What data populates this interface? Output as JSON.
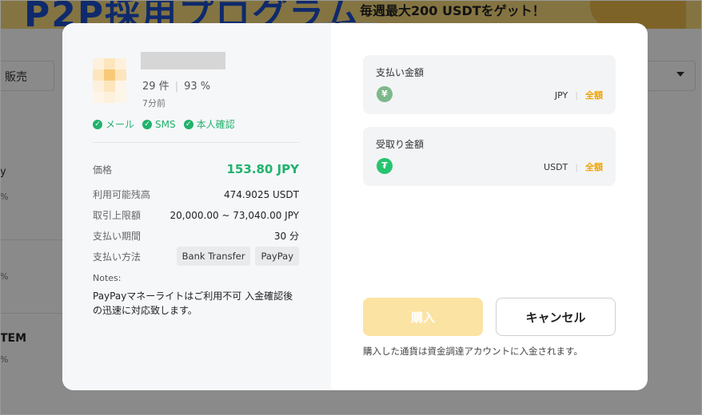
{
  "background": {
    "banner_big_text": "P2P採用プログラム",
    "banner_promo_text": "毎週最大200 USDTをゲット！",
    "filter_select_text": "販売",
    "partial_row_1": "y",
    "partial_row_1b": "%",
    "partial_row_2": "%",
    "partial_row_3": "TEM",
    "partial_row_3b": "%"
  },
  "advertiser": {
    "orders": "29 件",
    "completion": "93 %",
    "last_seen": "7分前",
    "verifications": [
      "メール",
      "SMS",
      "本人確認"
    ]
  },
  "details": {
    "price_label": "価格",
    "price_value": "153.80 JPY",
    "available_label": "利用可能残高",
    "available_value": "474.9025 USDT",
    "limit_label": "取引上限額",
    "limit_value": "20,000.00 ~ 73,040.00 JPY",
    "period_label": "支払い期間",
    "period_value": "30 分",
    "method_label": "支払い方法",
    "methods": [
      "Bank Transfer",
      "PayPay"
    ],
    "notes_label": "Notes:",
    "notes_text": "PayPayマネーライトはご利用不可 入金確認後の迅速に対応致します。"
  },
  "pay": {
    "label": "支払い金額",
    "coin_icon": "¥",
    "currency": "JPY",
    "all_label": "全額"
  },
  "receive": {
    "label": "受取り金額",
    "coin_icon": "₮",
    "currency": "USDT",
    "all_label": "全額"
  },
  "actions": {
    "buy_label": "購入",
    "cancel_label": "キャンセル",
    "footnote": "購入した通貨は資金調達アカウントに入金されます。"
  },
  "colors": {
    "accent_green": "#20b26c",
    "accent_orange": "#f0a500",
    "buy_disabled": "#fbe3a3"
  }
}
